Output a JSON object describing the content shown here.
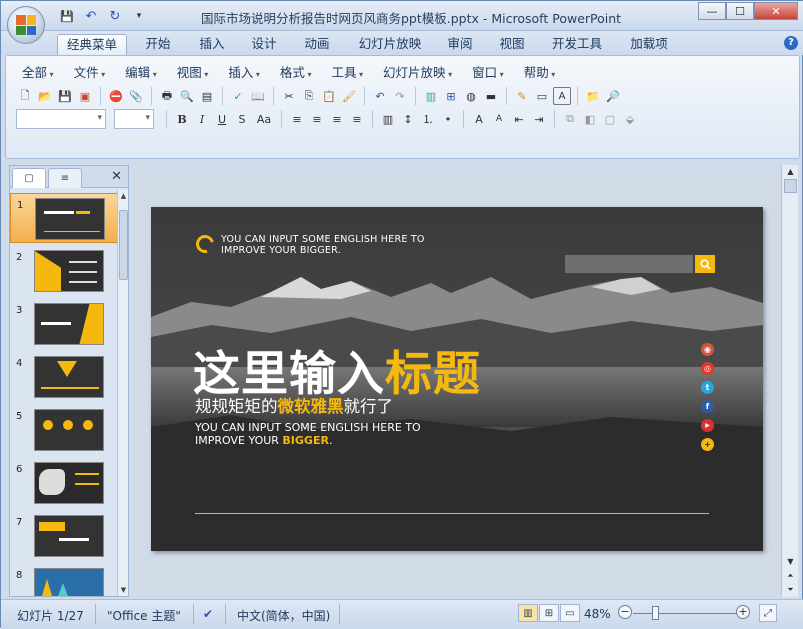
{
  "window": {
    "title": "国际市场说明分析报告时网页风商务ppt模板.pptx - Microsoft PowerPoint",
    "controls": [
      "—",
      "☐",
      "✕"
    ]
  },
  "qat": {
    "save": "💾",
    "undo": "↶",
    "redo": "↻",
    "more": "▾"
  },
  "tabs": [
    {
      "label": "经典菜单",
      "active": true
    },
    {
      "label": "开始"
    },
    {
      "label": "插入"
    },
    {
      "label": "设计"
    },
    {
      "label": "动画"
    },
    {
      "label": "幻灯片放映"
    },
    {
      "label": "审阅"
    },
    {
      "label": "视图"
    },
    {
      "label": "开发工具"
    },
    {
      "label": "加载项"
    }
  ],
  "menu": [
    "全部",
    "文件",
    "编辑",
    "视图",
    "插入",
    "格式",
    "工具",
    "幻灯片放映",
    "窗口",
    "帮助"
  ],
  "toolbar1": [
    "new-icon",
    "open-icon",
    "save-icon",
    "pdf-icon",
    "|",
    "permission-icon",
    "attach-icon",
    "|",
    "print-icon",
    "preview-icon",
    "layout-icon",
    "|",
    "spelling-icon",
    "research-icon",
    "|",
    "cut-icon",
    "copy-icon",
    "paste-icon",
    "format-painter-icon",
    "|",
    "undo-icon",
    "redo-icon",
    "|",
    "chart-icon",
    "table-icon",
    "clipart-icon",
    "shape-icon",
    "|",
    "textbox-icon",
    "header-icon",
    "a-box-icon",
    "|",
    "folder-icon",
    "find-icon"
  ],
  "toolbar2": {
    "font_value": "",
    "size_value": "",
    "format_buttons": [
      "B",
      "I",
      "U",
      "S",
      "Aa"
    ],
    "align_buttons": [
      "≡",
      "≡",
      "≡",
      "≡"
    ]
  },
  "slide_panel": {
    "tabs": [
      "▢",
      "≡"
    ],
    "close": "✕",
    "slides": [
      {
        "num": "1",
        "selected": true
      },
      {
        "num": "2"
      },
      {
        "num": "3"
      },
      {
        "num": "4"
      },
      {
        "num": "5"
      },
      {
        "num": "6"
      },
      {
        "num": "7"
      },
      {
        "num": "8"
      }
    ]
  },
  "slide": {
    "top_english": "YOU CAN INPUT SOME ENGLISH HERE TO\nIMPROVE YOUR BIGGER.",
    "title_white": "这里输入",
    "title_yellow": "标题",
    "subtitle_a": "规规矩矩的",
    "subtitle_hl": "微软雅黑",
    "subtitle_b": "就行了",
    "english_line1": "YOU CAN INPUT SOME ENGLISH HERE TO",
    "english_line2a": "IMPROVE YOUR ",
    "english_line2_hl": "BIGGER",
    "english_line2b": ".",
    "socials": [
      {
        "icon": "user-icon",
        "color": "#d9533f",
        "glyph": "◉"
      },
      {
        "icon": "weibo-icon",
        "color": "#e2372f",
        "glyph": "◎"
      },
      {
        "icon": "twitter-icon",
        "color": "#2aa4de",
        "glyph": "t"
      },
      {
        "icon": "facebook-icon",
        "color": "#2b5da8",
        "glyph": "f"
      },
      {
        "icon": "youtube-icon",
        "color": "#d9322d",
        "glyph": "▶"
      },
      {
        "icon": "plus-icon",
        "color": "#f5b80e",
        "glyph": "+"
      }
    ],
    "accent": "#f5b80e"
  },
  "status": {
    "slide_info": "幻灯片 1/27",
    "theme": "\"Office 主题\"",
    "language": "中文(简体，中国)",
    "zoom": "48%"
  }
}
